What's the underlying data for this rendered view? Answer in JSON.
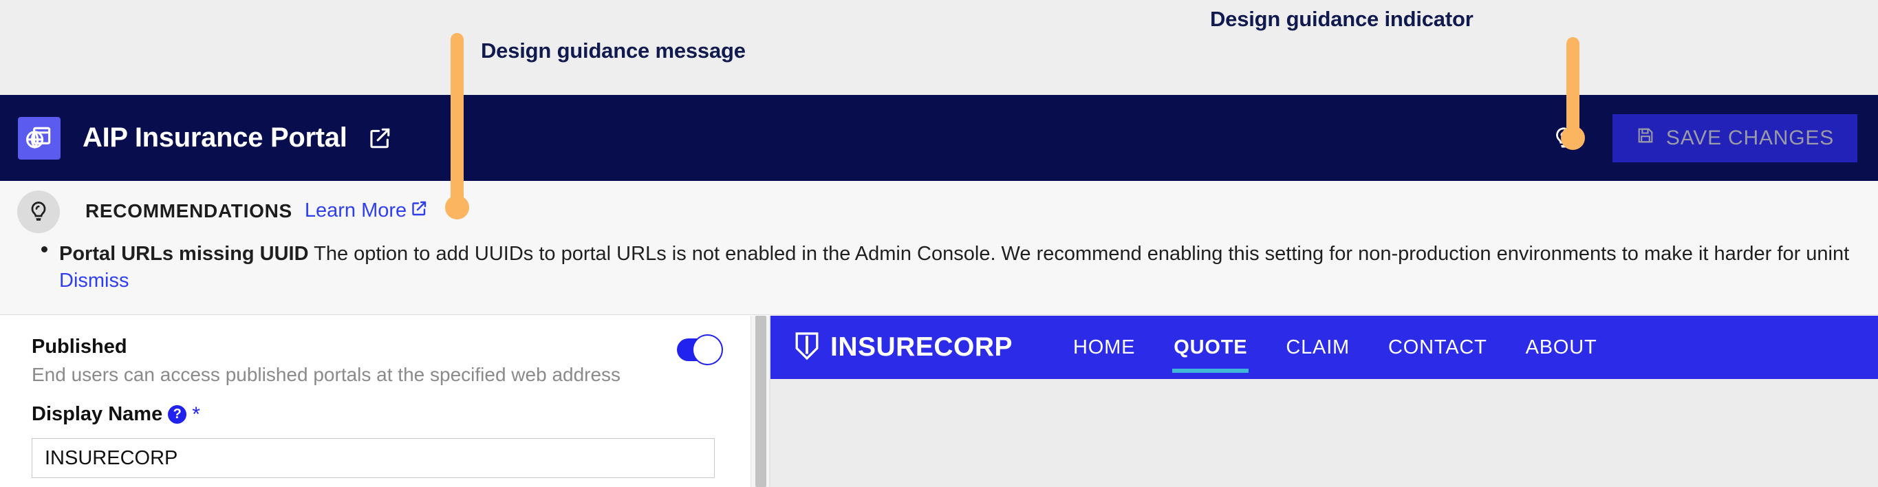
{
  "annotations": [
    {
      "id": "message",
      "label": "Design guidance message"
    },
    {
      "id": "indicator",
      "label": "Design guidance indicator"
    }
  ],
  "colors": {
    "header_bg": "#070d4d",
    "accent_orange": "#fbb560",
    "annotation_text": "#111a4f",
    "link_blue": "#2f3ff0",
    "toggle_blue": "#2222ee",
    "portal_blue": "#2b2be8",
    "portal_active_underline": "#3fb8d8",
    "save_button_bg": "#2222b8",
    "app_icon_bg": "#5b5bf0"
  },
  "header": {
    "app_icon": "globe-browser-icon",
    "title": "AIP Insurance Portal",
    "external_link_icon": "external-link-icon",
    "guidance_icon": "lightbulb-icon",
    "save_label": "SAVE CHANGES",
    "save_icon": "floppy-disk-icon"
  },
  "recommendations": {
    "badge_icon": "lightbulb-icon",
    "title": "RECOMMENDATIONS",
    "learn_more_label": "Learn More",
    "learn_more_icon": "external-link-icon",
    "item": {
      "title": "Portal URLs missing UUID",
      "body": "The option to add UUIDs to portal URLs is not enabled in the Admin Console. We recommend enabling this setting for non-production environments to make it harder for unint",
      "dismiss_label": "Dismiss"
    }
  },
  "settings": {
    "published": {
      "label": "Published",
      "description": "End users can access published portals at the specified web address",
      "toggle_state": "on"
    },
    "display_name": {
      "label": "Display Name",
      "help_icon": "question-mark-icon",
      "required_marker": "*",
      "value": "INSURECORP",
      "placeholder": "Display Name"
    }
  },
  "preview": {
    "brand_icon": "shield-icon",
    "brand_name": "INSURECORP",
    "nav_items": [
      {
        "label": "HOME",
        "active": false
      },
      {
        "label": "QUOTE",
        "active": true
      },
      {
        "label": "CLAIM",
        "active": false
      },
      {
        "label": "CONTACT",
        "active": false
      },
      {
        "label": "ABOUT",
        "active": false
      }
    ]
  }
}
